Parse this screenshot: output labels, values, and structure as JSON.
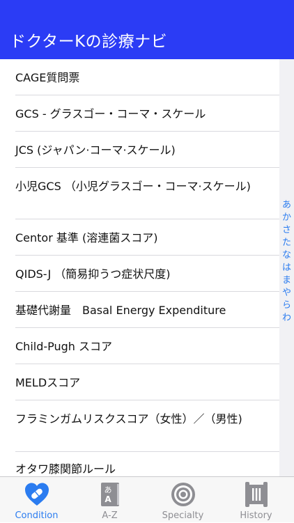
{
  "header": {
    "title": "ドクターKの診療ナビ"
  },
  "list": {
    "items": [
      "CAGE質問票",
      "GCS - グラスゴー・コーマ・スケール",
      "JCS (ジャパン·コーマ·スケール)",
      "小児GCS （小児グラスゴー・コーマ·スケール)",
      "Centor 基準 (溶連菌スコア)",
      "QIDS-J （簡易抑うつ症状尺度)",
      "基礎代謝量　Basal Energy Expenditure",
      "Child-Pugh スコア",
      "MELDスコア",
      "フラミンガムリスクスコア（女性）／（男性)",
      "オタワ膝関節ルール"
    ]
  },
  "index_bar": {
    "letters": [
      "あ",
      "か",
      "さ",
      "た",
      "な",
      "は",
      "ま",
      "や",
      "ら",
      "わ"
    ]
  },
  "tabbar": {
    "tabs": [
      {
        "label": "Condition",
        "icon": "heart-pill-icon",
        "active": true
      },
      {
        "label": "A-Z",
        "icon": "dictionary-book-icon",
        "active": false
      },
      {
        "label": "Specialty",
        "icon": "target-icon",
        "active": false
      },
      {
        "label": "History",
        "icon": "history-scroll-icon",
        "active": false
      }
    ]
  },
  "colors": {
    "nav_background": "#2b3cf5",
    "accent": "#2b7cf0",
    "inactive_tab": "#8e8e93"
  }
}
